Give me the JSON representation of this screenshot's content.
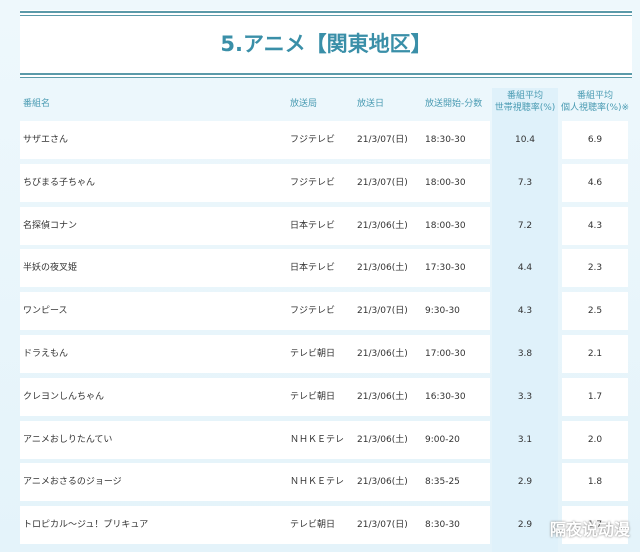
{
  "title": "5.アニメ【関東地区】",
  "headers": {
    "name": "番組名",
    "station": "放送局",
    "date": "放送日",
    "time": "放送開始-分数",
    "household_1": "番組平均",
    "household_2": "世帯視聴率(%)",
    "individual_1": "番組平均",
    "individual_2": "個人視聴率(%)※"
  },
  "rows": [
    {
      "name": "サザエさん",
      "station": "フジテレビ",
      "date": "21/3/07(日)",
      "time": "18:30-30",
      "household": "10.4",
      "individual": "6.9"
    },
    {
      "name": "ちびまる子ちゃん",
      "station": "フジテレビ",
      "date": "21/3/07(日)",
      "time": "18:00-30",
      "household": "7.3",
      "individual": "4.6"
    },
    {
      "name": "名探偵コナン",
      "station": "日本テレビ",
      "date": "21/3/06(土)",
      "time": "18:00-30",
      "household": "7.2",
      "individual": "4.3"
    },
    {
      "name": "半妖の夜叉姫",
      "station": "日本テレビ",
      "date": "21/3/06(土)",
      "time": "17:30-30",
      "household": "4.4",
      "individual": "2.3"
    },
    {
      "name": "ワンピース",
      "station": "フジテレビ",
      "date": "21/3/07(日)",
      "time": "9:30-30",
      "household": "4.3",
      "individual": "2.5"
    },
    {
      "name": "ドラえもん",
      "station": "テレビ朝日",
      "date": "21/3/06(土)",
      "time": "17:00-30",
      "household": "3.8",
      "individual": "2.1"
    },
    {
      "name": "クレヨンしんちゃん",
      "station": "テレビ朝日",
      "date": "21/3/06(土)",
      "time": "16:30-30",
      "household": "3.3",
      "individual": "1.7"
    },
    {
      "name": "アニメおしりたんてい",
      "station": "ＮＨＫＥテレ",
      "date": "21/3/06(土)",
      "time": "9:00-20",
      "household": "3.1",
      "individual": "2.0"
    },
    {
      "name": "アニメおさるのジョージ",
      "station": "ＮＨＫＥテレ",
      "date": "21/3/06(土)",
      "time": "8:35-25",
      "household": "2.9",
      "individual": "1.8"
    },
    {
      "name": "トロピカル～ジュ！プリキュア",
      "station": "テレビ朝日",
      "date": "21/3/07(日)",
      "time": "8:30-30",
      "household": "2.9",
      "individual": "1.7"
    }
  ],
  "watermark": "隔夜说动漫"
}
